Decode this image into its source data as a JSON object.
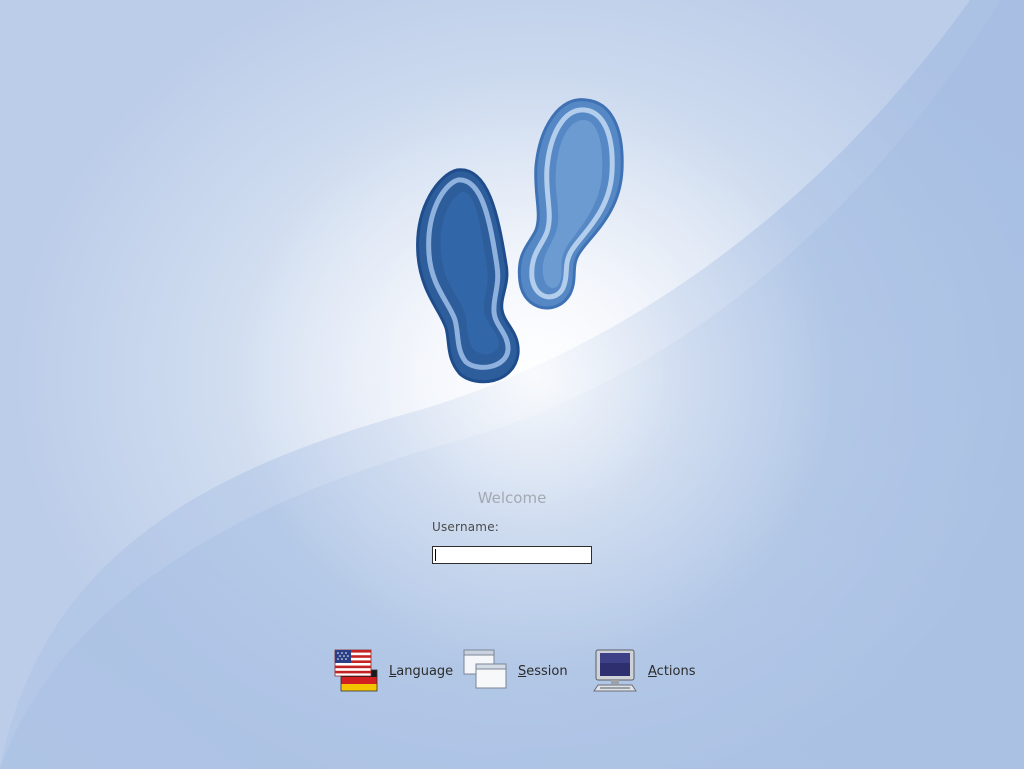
{
  "greeter": {
    "welcome": "Welcome",
    "username_label": "Username:",
    "username_value": ""
  },
  "bottom_bar": {
    "language": {
      "first": "L",
      "rest": "anguage",
      "icon": "flag-icon"
    },
    "session": {
      "first": "S",
      "rest": "ession",
      "icon": "windows-icon"
    },
    "actions": {
      "first": "A",
      "rest": "ctions",
      "icon": "computer-icon"
    }
  },
  "colors": {
    "background_light": "#f7f9fd",
    "background_dark": "#a9bfe2",
    "logo_dark": "#2f5f9f",
    "logo_light": "#6c9bd0"
  },
  "logo": {
    "icon": "footprints-logo"
  }
}
